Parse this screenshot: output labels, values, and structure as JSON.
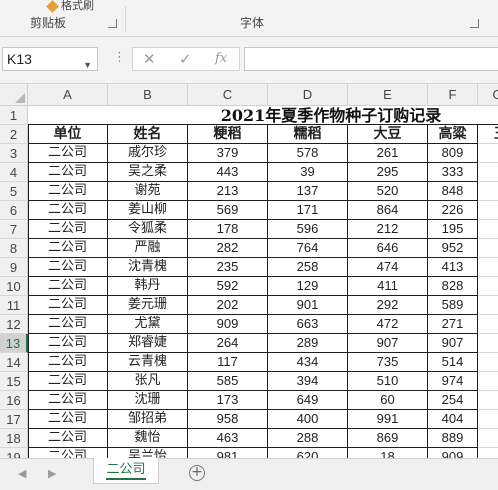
{
  "ribbon": {
    "partial_button_label": "格式刷",
    "groups": [
      {
        "label": "剪贴板"
      },
      {
        "label": "字体"
      }
    ]
  },
  "formula_bar": {
    "name_box": "K13",
    "cancel_glyph": "✕",
    "enter_glyph": "✓",
    "function_glyph": "fx",
    "formula": ""
  },
  "sheet": {
    "columns": [
      "A",
      "B",
      "C",
      "D",
      "E",
      "F",
      "G"
    ],
    "row_numbers": [
      "1",
      "2",
      "3",
      "4",
      "5",
      "6",
      "7",
      "8",
      "9",
      "10",
      "11",
      "12",
      "13",
      "14",
      "15",
      "16",
      "17",
      "18",
      "19"
    ],
    "active_row": "13",
    "title": "2021年夏季作物种子订购记录",
    "headers": [
      "单位",
      "姓名",
      "粳稻",
      "糯稻",
      "大豆",
      "高粱",
      "玉"
    ],
    "rows": [
      [
        "二公司",
        "戚尔珍",
        "379",
        "578",
        "261",
        "809"
      ],
      [
        "二公司",
        "吴之柔",
        "443",
        "39",
        "295",
        "333"
      ],
      [
        "二公司",
        "谢苑",
        "213",
        "137",
        "520",
        "848"
      ],
      [
        "二公司",
        "姜山柳",
        "569",
        "171",
        "864",
        "226"
      ],
      [
        "二公司",
        "令狐柔",
        "178",
        "596",
        "212",
        "195"
      ],
      [
        "二公司",
        "严融",
        "282",
        "764",
        "646",
        "952"
      ],
      [
        "二公司",
        "沈青槐",
        "235",
        "258",
        "474",
        "413"
      ],
      [
        "二公司",
        "韩丹",
        "592",
        "129",
        "411",
        "828"
      ],
      [
        "二公司",
        "姜元珊",
        "202",
        "901",
        "292",
        "589"
      ],
      [
        "二公司",
        "尤黛",
        "909",
        "663",
        "472",
        "271"
      ],
      [
        "二公司",
        "郑睿婕",
        "264",
        "289",
        "907",
        "907"
      ],
      [
        "二公司",
        "云青槐",
        "117",
        "434",
        "735",
        "514"
      ],
      [
        "二公司",
        "张凡",
        "585",
        "394",
        "510",
        "974"
      ],
      [
        "二公司",
        "沈珊",
        "173",
        "649",
        "60",
        "254"
      ],
      [
        "二公司",
        "邹招弟",
        "958",
        "400",
        "991",
        "404"
      ],
      [
        "二公司",
        "魏怡",
        "463",
        "288",
        "869",
        "889"
      ],
      [
        "二公司",
        "吴兰怡",
        "981",
        "620",
        "18",
        "909"
      ]
    ]
  },
  "tabs": {
    "sheet_name": "二公司",
    "add_glyph": "+",
    "prev_glyph": "◀",
    "next_glyph": "▶"
  }
}
